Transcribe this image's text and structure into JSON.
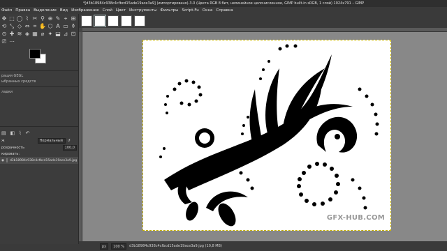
{
  "window": {
    "title": "*[d3b18984c938c4cfbcd15ade19ace3a9] (импортировано)-3.0 (Цвета RGB 8 бит, нелинейное целочисленное, GIMP built-in sRGB, 1 слой) 1024x791 – GIMP"
  },
  "menu": [
    "Файл",
    "Правка",
    "Выделение",
    "Вид",
    "Изображение",
    "Слой",
    "Цвет",
    "Инструменты",
    "Фильтры",
    "Script-Fu",
    "Окна",
    "Справка"
  ],
  "toolbox": {
    "tool_glyphs": [
      "✥",
      "⬚",
      "◯",
      "⌇",
      "✂",
      "⚲",
      "⊕",
      "✎",
      "⌖",
      "⊞",
      "⟲",
      "⤡",
      "◇",
      "⇔",
      "⌗",
      "✋",
      "⬡",
      "A",
      "▭",
      "⚱",
      "⊙",
      "✚",
      "≋",
      "◈",
      "▦",
      "⌀",
      "✦",
      "⬓",
      "⊿",
      "⊡",
      "⎚",
      "⋯"
    ],
    "brush_label": "рация GEGL",
    "blend_hint": "ыбранных средств",
    "radius_label": "ладки"
  },
  "layers": {
    "mode_label": "Нормальный",
    "opacity_label": "розрачность",
    "opacity_value": "100,0",
    "lock_label": "кировать:",
    "layer_name": "d3b18984c938c4cfbcd15ade19ace3a9.jpg"
  },
  "status": {
    "unit": "px",
    "zoom": "100 %",
    "file_info": "d3b18984c938c4cfbcd15ade19ace3a9.jpg (10,8 МВ)"
  },
  "watermark": "GFX-HUB.COM",
  "colors": {
    "foreground": "#000000",
    "background": "#ffffff"
  }
}
